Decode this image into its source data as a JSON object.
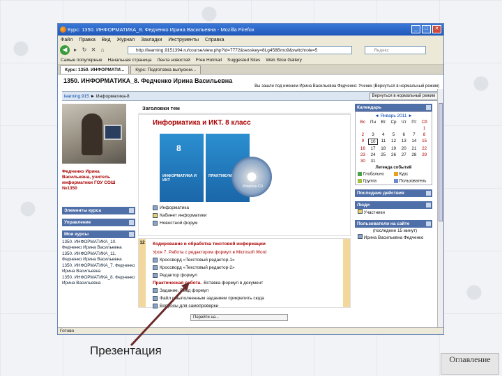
{
  "window": {
    "title": "Курс: 1350. ИНФОРМАТИКА_8. Федченко Ирина Васильевна - Mozilla Firefox"
  },
  "menu": [
    "Файл",
    "Правка",
    "Вид",
    "Журнал",
    "Закладки",
    "Инструменты",
    "Справка"
  ],
  "url": "http://learning.9151394.ru/course/view.php?id=7772&sesskey=8Lg458Bmo9&switchrole=5",
  "search_placeholder": "Яндекс",
  "bookmarks": [
    "Самые популярные",
    "Начальная страница",
    "Лента новостей",
    "Free Hotmail",
    "Suggested Sites",
    "Web Slice Gallery"
  ],
  "tabs": [
    "Курс: 1350. ИНФОРМАТИ...",
    "Курс: Подготовка выпускни..."
  ],
  "course_title": "1350. ИНФОРМАТИКА_8. Федченко Ирина Васильевна",
  "login_info": "Вы зашли под именем Ирина Васильевна Федченко: Ученик (Вернуться в нормальный режим)",
  "breadcrumb": {
    "home": "learning.915",
    "sep": "►",
    "current": "Информатика-8"
  },
  "normal_mode_button": "Вернуться в нормальный режим",
  "teacher": "Федченко Ирина Васильевна, учитель информатики ГОУ СОШ №1350",
  "left_blocks": {
    "elements": "Элементы курса",
    "management": "Управление",
    "my_courses": "Мои курсы"
  },
  "my_courses": [
    "1350. ИНФОРМАТИКА_10. Федченко Ирина Васильевна",
    "1350. ИНФОРМАТИКА_11. Федченко Ирина Васильевна",
    "1350. ИНФОРМАТИКА_7. Федченко Ирина Васильевна",
    "1350. ИНФОРМАТИКА_8. Федченко Ирина Васильевна"
  ],
  "themes_header": "Заголовки тем",
  "section0": {
    "title": "Информатика и ИКТ. 8 класс",
    "book1_num": "8",
    "book1_title": "ИНФОРМАТИКА И ИКТ",
    "book2_title": "ПРАКТИКУМ",
    "cd_label": "Windows-CD",
    "links": [
      "Информатика",
      "Кабинет информатики",
      "Новостной форум"
    ]
  },
  "section12": {
    "num": "12",
    "title": "Кодирование и обработка текстовой информации",
    "lesson": "Урок 7. Работа с редактором формул в Microsoft Word",
    "items": [
      "Кроссворд «Текстовый редактор-1»",
      "Кроссворд «Текстовый редактор-2»",
      "Редактор формул"
    ],
    "prakt_bold": "Практическая работа.",
    "prakt_rest": " Вставка формул в документ",
    "items2": [
      "Задание. Ввод формул",
      "Файл с выполненным заданием прикрепить сюда",
      "Вопросы для самопроверки"
    ]
  },
  "jump_select": "Перейти на...",
  "calendar": {
    "header": "Календарь",
    "month": "Январь 2011",
    "days": [
      "Вс",
      "Пн",
      "Вт",
      "Ср",
      "Чт",
      "Пт",
      "Сб"
    ],
    "cells": [
      "",
      "",
      "",
      "",
      "",
      "",
      "1",
      "2",
      "3",
      "4",
      "5",
      "6",
      "7",
      "8",
      "9",
      "10",
      "11",
      "12",
      "13",
      "14",
      "15",
      "16",
      "17",
      "18",
      "19",
      "20",
      "21",
      "22",
      "23",
      "24",
      "25",
      "26",
      "27",
      "28",
      "29",
      "30",
      "31",
      "",
      "",
      "",
      "",
      ""
    ],
    "today": "10"
  },
  "legend": {
    "title": "Легенда событий",
    "items": [
      "Глобально",
      "Курс",
      "Группа",
      "Пользователь"
    ],
    "colors": [
      "#4aa34a",
      "#e8a020",
      "#a0c040",
      "#6a8ad0"
    ]
  },
  "right_blocks": {
    "recent": "Последние действия",
    "people": "Люди",
    "participants": "Участники",
    "online": "Пользователи на сайте",
    "online_note": "(последние 15 минут)",
    "online_user": "Ирина Васильевна Федченко"
  },
  "status": "Готово",
  "annotation": "Презентация",
  "toc_button": "Оглавление"
}
